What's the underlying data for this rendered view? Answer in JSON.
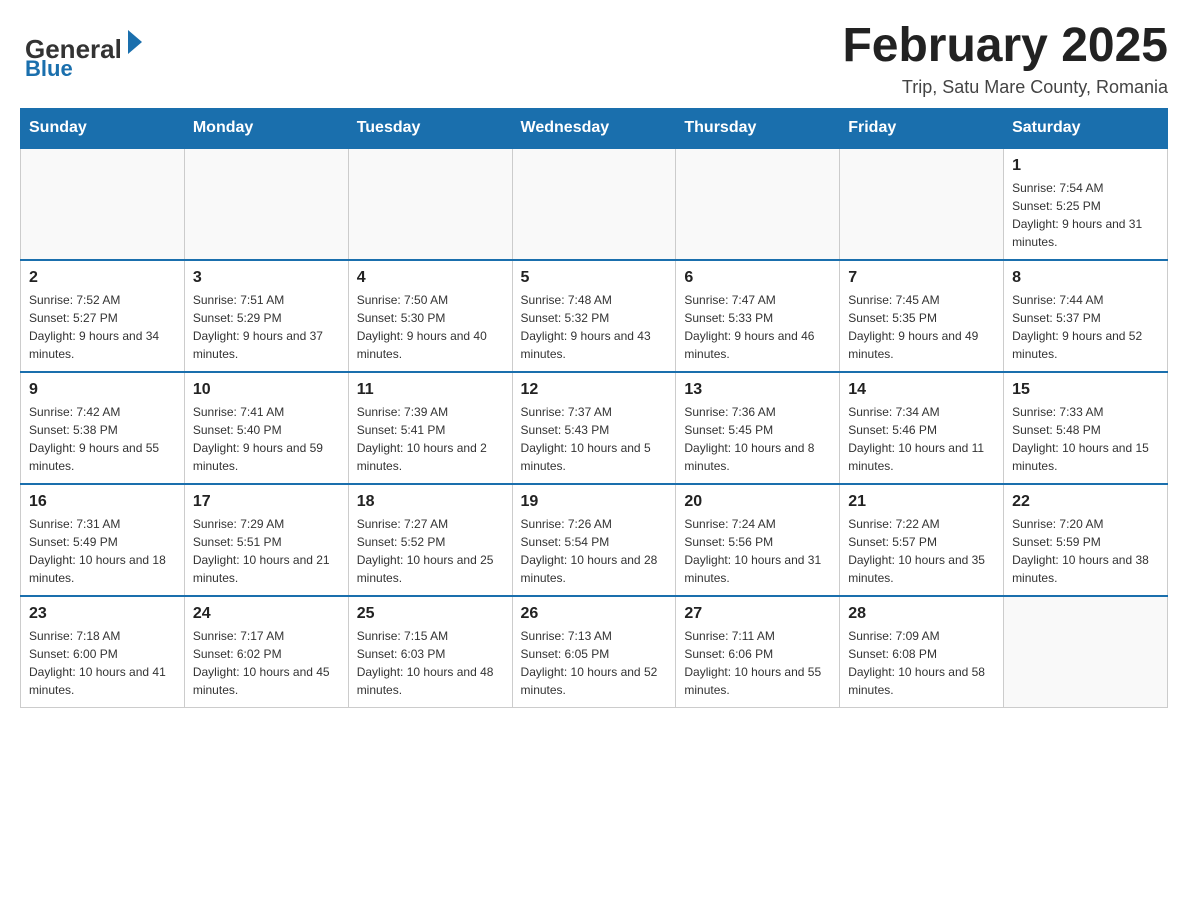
{
  "header": {
    "logo_general": "General",
    "logo_blue": "Blue",
    "title": "February 2025",
    "subtitle": "Trip, Satu Mare County, Romania"
  },
  "calendar": {
    "days_of_week": [
      "Sunday",
      "Monday",
      "Tuesday",
      "Wednesday",
      "Thursday",
      "Friday",
      "Saturday"
    ],
    "weeks": [
      [
        {
          "day": "",
          "info": ""
        },
        {
          "day": "",
          "info": ""
        },
        {
          "day": "",
          "info": ""
        },
        {
          "day": "",
          "info": ""
        },
        {
          "day": "",
          "info": ""
        },
        {
          "day": "",
          "info": ""
        },
        {
          "day": "1",
          "info": "Sunrise: 7:54 AM\nSunset: 5:25 PM\nDaylight: 9 hours and 31 minutes."
        }
      ],
      [
        {
          "day": "2",
          "info": "Sunrise: 7:52 AM\nSunset: 5:27 PM\nDaylight: 9 hours and 34 minutes."
        },
        {
          "day": "3",
          "info": "Sunrise: 7:51 AM\nSunset: 5:29 PM\nDaylight: 9 hours and 37 minutes."
        },
        {
          "day": "4",
          "info": "Sunrise: 7:50 AM\nSunset: 5:30 PM\nDaylight: 9 hours and 40 minutes."
        },
        {
          "day": "5",
          "info": "Sunrise: 7:48 AM\nSunset: 5:32 PM\nDaylight: 9 hours and 43 minutes."
        },
        {
          "day": "6",
          "info": "Sunrise: 7:47 AM\nSunset: 5:33 PM\nDaylight: 9 hours and 46 minutes."
        },
        {
          "day": "7",
          "info": "Sunrise: 7:45 AM\nSunset: 5:35 PM\nDaylight: 9 hours and 49 minutes."
        },
        {
          "day": "8",
          "info": "Sunrise: 7:44 AM\nSunset: 5:37 PM\nDaylight: 9 hours and 52 minutes."
        }
      ],
      [
        {
          "day": "9",
          "info": "Sunrise: 7:42 AM\nSunset: 5:38 PM\nDaylight: 9 hours and 55 minutes."
        },
        {
          "day": "10",
          "info": "Sunrise: 7:41 AM\nSunset: 5:40 PM\nDaylight: 9 hours and 59 minutes."
        },
        {
          "day": "11",
          "info": "Sunrise: 7:39 AM\nSunset: 5:41 PM\nDaylight: 10 hours and 2 minutes."
        },
        {
          "day": "12",
          "info": "Sunrise: 7:37 AM\nSunset: 5:43 PM\nDaylight: 10 hours and 5 minutes."
        },
        {
          "day": "13",
          "info": "Sunrise: 7:36 AM\nSunset: 5:45 PM\nDaylight: 10 hours and 8 minutes."
        },
        {
          "day": "14",
          "info": "Sunrise: 7:34 AM\nSunset: 5:46 PM\nDaylight: 10 hours and 11 minutes."
        },
        {
          "day": "15",
          "info": "Sunrise: 7:33 AM\nSunset: 5:48 PM\nDaylight: 10 hours and 15 minutes."
        }
      ],
      [
        {
          "day": "16",
          "info": "Sunrise: 7:31 AM\nSunset: 5:49 PM\nDaylight: 10 hours and 18 minutes."
        },
        {
          "day": "17",
          "info": "Sunrise: 7:29 AM\nSunset: 5:51 PM\nDaylight: 10 hours and 21 minutes."
        },
        {
          "day": "18",
          "info": "Sunrise: 7:27 AM\nSunset: 5:52 PM\nDaylight: 10 hours and 25 minutes."
        },
        {
          "day": "19",
          "info": "Sunrise: 7:26 AM\nSunset: 5:54 PM\nDaylight: 10 hours and 28 minutes."
        },
        {
          "day": "20",
          "info": "Sunrise: 7:24 AM\nSunset: 5:56 PM\nDaylight: 10 hours and 31 minutes."
        },
        {
          "day": "21",
          "info": "Sunrise: 7:22 AM\nSunset: 5:57 PM\nDaylight: 10 hours and 35 minutes."
        },
        {
          "day": "22",
          "info": "Sunrise: 7:20 AM\nSunset: 5:59 PM\nDaylight: 10 hours and 38 minutes."
        }
      ],
      [
        {
          "day": "23",
          "info": "Sunrise: 7:18 AM\nSunset: 6:00 PM\nDaylight: 10 hours and 41 minutes."
        },
        {
          "day": "24",
          "info": "Sunrise: 7:17 AM\nSunset: 6:02 PM\nDaylight: 10 hours and 45 minutes."
        },
        {
          "day": "25",
          "info": "Sunrise: 7:15 AM\nSunset: 6:03 PM\nDaylight: 10 hours and 48 minutes."
        },
        {
          "day": "26",
          "info": "Sunrise: 7:13 AM\nSunset: 6:05 PM\nDaylight: 10 hours and 52 minutes."
        },
        {
          "day": "27",
          "info": "Sunrise: 7:11 AM\nSunset: 6:06 PM\nDaylight: 10 hours and 55 minutes."
        },
        {
          "day": "28",
          "info": "Sunrise: 7:09 AM\nSunset: 6:08 PM\nDaylight: 10 hours and 58 minutes."
        },
        {
          "day": "",
          "info": ""
        }
      ]
    ]
  }
}
